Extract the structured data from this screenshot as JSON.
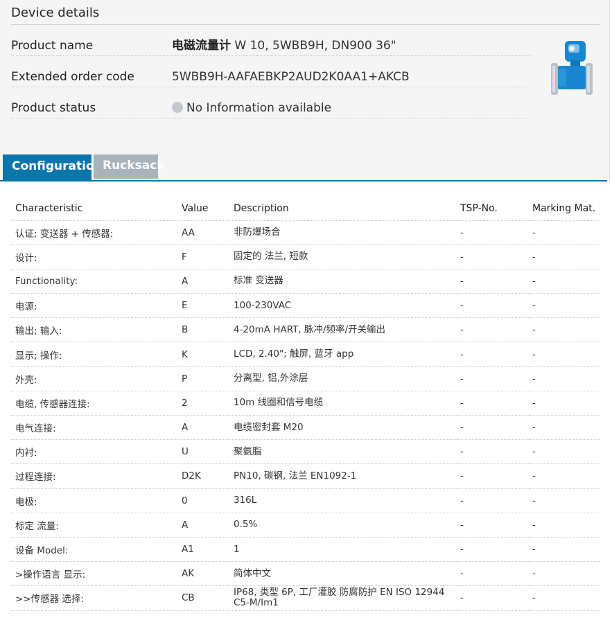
{
  "device_details": {
    "section_title": "Device details",
    "rows": [
      {
        "label": "Product name",
        "value_bold": "电磁流量计",
        "value": " W 10, 5WBB9H, DN900 36\""
      },
      {
        "label": "Extended order code",
        "value": "5WBB9H-AAFAEBKP2AUD2K0AA1+AKCB"
      },
      {
        "label": "Product status",
        "value": "No Information available"
      }
    ],
    "status_color": "#c4c9ce",
    "device_image": "flowmeter-device-image"
  },
  "tabs": [
    {
      "label": "Configuration",
      "active": true
    },
    {
      "label": "Rucksack",
      "active": false
    }
  ],
  "colors": {
    "accent": "#0b76ab",
    "tab_inactive": "#a9b3bc"
  },
  "table": {
    "headers": [
      "Characteristic",
      "Value",
      "Description",
      "TSP-No.",
      "Marking Mat."
    ],
    "rows": [
      [
        "认证; 变送器 + 传感器:",
        "AA",
        "非防爆场合",
        "-",
        "-"
      ],
      [
        "设计:",
        "F",
        "固定的 法兰, 短款",
        "-",
        "-"
      ],
      [
        "Functionality:",
        "A",
        "标准 变送器",
        "-",
        "-"
      ],
      [
        "电源:",
        "E",
        "100-230VAC",
        "-",
        "-"
      ],
      [
        "输出; 输入:",
        "B",
        "4-20mA HART, 脉冲/频率/开关输出",
        "-",
        "-"
      ],
      [
        "显示; 操作:",
        "K",
        "LCD, 2.40\"; 触屏, 蓝牙 app",
        "-",
        "-"
      ],
      [
        "外壳:",
        "P",
        "分离型, 铝,外涂层",
        "-",
        "-"
      ],
      [
        "电缆, 传感器连接:",
        "2",
        "10m 线圈和信号电缆",
        "-",
        "-"
      ],
      [
        "电气连接:",
        "A",
        "电缆密封套 M20",
        "-",
        "-"
      ],
      [
        "内衬:",
        "U",
        "聚氨脂",
        "-",
        "-"
      ],
      [
        "过程连接:",
        "D2K",
        "PN10, 碳钢, 法兰 EN1092-1",
        "-",
        "-"
      ],
      [
        "电极:",
        "0",
        "316L",
        "-",
        "-"
      ],
      [
        "标定 流量:",
        "A",
        "0.5%",
        "-",
        "-"
      ],
      [
        "设备 Model:",
        "A1",
        "1",
        "-",
        "-"
      ],
      [
        ">操作语言 显示:",
        "AK",
        "简体中文",
        "-",
        "-"
      ],
      [
        ">>传感器 选择:",
        "CB",
        "IP68, 类型 6P, 工厂灌胶 防腐防护 EN ISO 12944 C5-M/Im1",
        "-",
        "-"
      ]
    ]
  }
}
